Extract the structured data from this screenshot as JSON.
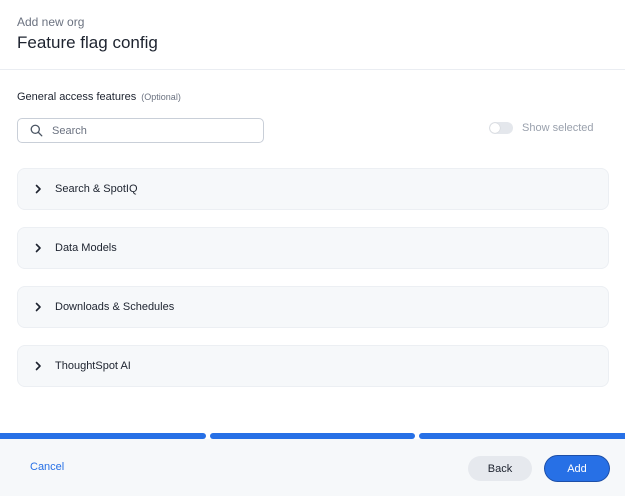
{
  "header": {
    "subtitle": "Add new org",
    "title": "Feature flag config"
  },
  "section": {
    "label": "General access features",
    "optional": "(Optional)"
  },
  "search": {
    "placeholder": "Search",
    "value": ""
  },
  "toggle": {
    "label": "Show selected",
    "checked": false
  },
  "accordions": [
    {
      "label": "Search & SpotIQ",
      "expanded": false
    },
    {
      "label": "Data Models",
      "expanded": false
    },
    {
      "label": "Downloads & Schedules",
      "expanded": false
    },
    {
      "label": "ThoughtSpot AI",
      "expanded": false
    }
  ],
  "progress": {
    "completed_steps": 3,
    "total_steps": 3
  },
  "footer": {
    "cancel_label": "Cancel",
    "back_label": "Back",
    "add_label": "Add"
  },
  "colors": {
    "accent": "#2770e6",
    "text": "#1d232f",
    "muted": "#6b7280"
  }
}
